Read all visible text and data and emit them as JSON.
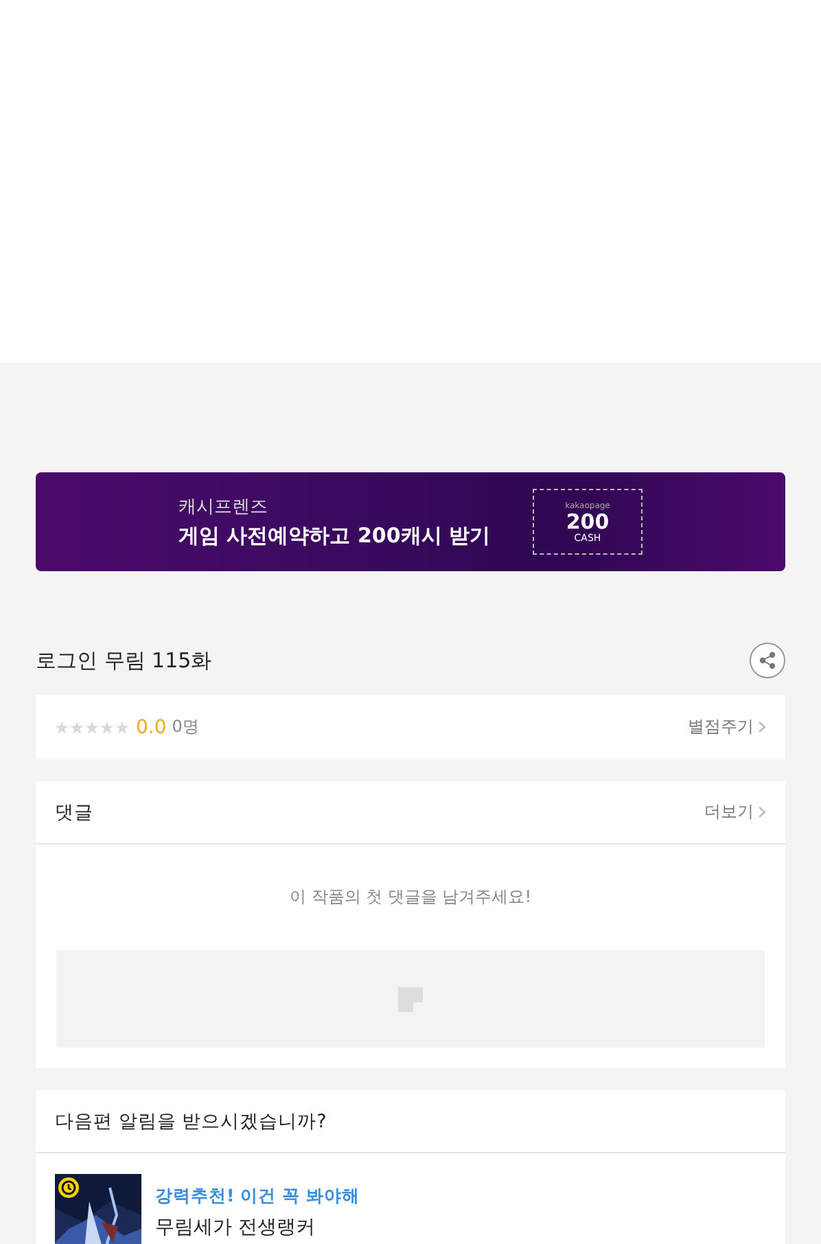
{
  "banner": {
    "subtitle": "캐시프렌즈",
    "title": "게임 사전예약하고 200캐시 받기",
    "coupon": {
      "brand": "kakaopage",
      "amount": "200",
      "unit": "CASH"
    }
  },
  "episode": {
    "title": "로그인 무림 115화"
  },
  "rating": {
    "stars": 0,
    "score": "0.0",
    "count": "0명",
    "action": "별점주기"
  },
  "comments": {
    "title": "댓글",
    "more": "더보기",
    "empty": "이 작품의 첫 댓글을 남겨주세요!"
  },
  "alert": {
    "title": "다음편 알림을 받으시겠습니까?",
    "items": [
      {
        "kind": "picture",
        "tagline": "강력추천! 이건 꼭 봐야해",
        "title": "무림세가 전생랭커",
        "waiting": true
      }
    ]
  }
}
